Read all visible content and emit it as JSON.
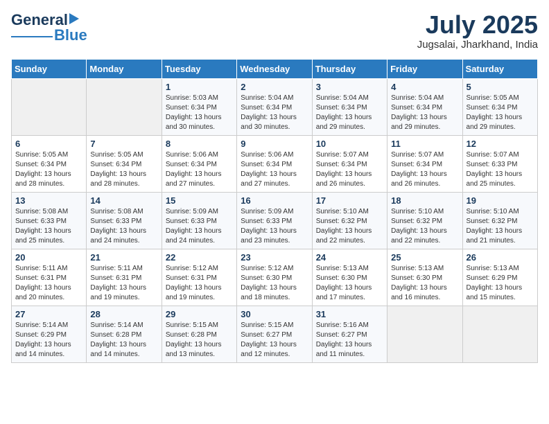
{
  "header": {
    "logo_general": "General",
    "logo_blue": "Blue",
    "month": "July 2025",
    "location": "Jugsalai, Jharkhand, India"
  },
  "days_of_week": [
    "Sunday",
    "Monday",
    "Tuesday",
    "Wednesday",
    "Thursday",
    "Friday",
    "Saturday"
  ],
  "weeks": [
    [
      {
        "day": "",
        "sunrise": "",
        "sunset": "",
        "daylight": ""
      },
      {
        "day": "",
        "sunrise": "",
        "sunset": "",
        "daylight": ""
      },
      {
        "day": "1",
        "sunrise": "Sunrise: 5:03 AM",
        "sunset": "Sunset: 6:34 PM",
        "daylight": "Daylight: 13 hours and 30 minutes."
      },
      {
        "day": "2",
        "sunrise": "Sunrise: 5:04 AM",
        "sunset": "Sunset: 6:34 PM",
        "daylight": "Daylight: 13 hours and 30 minutes."
      },
      {
        "day": "3",
        "sunrise": "Sunrise: 5:04 AM",
        "sunset": "Sunset: 6:34 PM",
        "daylight": "Daylight: 13 hours and 29 minutes."
      },
      {
        "day": "4",
        "sunrise": "Sunrise: 5:04 AM",
        "sunset": "Sunset: 6:34 PM",
        "daylight": "Daylight: 13 hours and 29 minutes."
      },
      {
        "day": "5",
        "sunrise": "Sunrise: 5:05 AM",
        "sunset": "Sunset: 6:34 PM",
        "daylight": "Daylight: 13 hours and 29 minutes."
      }
    ],
    [
      {
        "day": "6",
        "sunrise": "Sunrise: 5:05 AM",
        "sunset": "Sunset: 6:34 PM",
        "daylight": "Daylight: 13 hours and 28 minutes."
      },
      {
        "day": "7",
        "sunrise": "Sunrise: 5:05 AM",
        "sunset": "Sunset: 6:34 PM",
        "daylight": "Daylight: 13 hours and 28 minutes."
      },
      {
        "day": "8",
        "sunrise": "Sunrise: 5:06 AM",
        "sunset": "Sunset: 6:34 PM",
        "daylight": "Daylight: 13 hours and 27 minutes."
      },
      {
        "day": "9",
        "sunrise": "Sunrise: 5:06 AM",
        "sunset": "Sunset: 6:34 PM",
        "daylight": "Daylight: 13 hours and 27 minutes."
      },
      {
        "day": "10",
        "sunrise": "Sunrise: 5:07 AM",
        "sunset": "Sunset: 6:34 PM",
        "daylight": "Daylight: 13 hours and 26 minutes."
      },
      {
        "day": "11",
        "sunrise": "Sunrise: 5:07 AM",
        "sunset": "Sunset: 6:34 PM",
        "daylight": "Daylight: 13 hours and 26 minutes."
      },
      {
        "day": "12",
        "sunrise": "Sunrise: 5:07 AM",
        "sunset": "Sunset: 6:33 PM",
        "daylight": "Daylight: 13 hours and 25 minutes."
      }
    ],
    [
      {
        "day": "13",
        "sunrise": "Sunrise: 5:08 AM",
        "sunset": "Sunset: 6:33 PM",
        "daylight": "Daylight: 13 hours and 25 minutes."
      },
      {
        "day": "14",
        "sunrise": "Sunrise: 5:08 AM",
        "sunset": "Sunset: 6:33 PM",
        "daylight": "Daylight: 13 hours and 24 minutes."
      },
      {
        "day": "15",
        "sunrise": "Sunrise: 5:09 AM",
        "sunset": "Sunset: 6:33 PM",
        "daylight": "Daylight: 13 hours and 24 minutes."
      },
      {
        "day": "16",
        "sunrise": "Sunrise: 5:09 AM",
        "sunset": "Sunset: 6:33 PM",
        "daylight": "Daylight: 13 hours and 23 minutes."
      },
      {
        "day": "17",
        "sunrise": "Sunrise: 5:10 AM",
        "sunset": "Sunset: 6:32 PM",
        "daylight": "Daylight: 13 hours and 22 minutes."
      },
      {
        "day": "18",
        "sunrise": "Sunrise: 5:10 AM",
        "sunset": "Sunset: 6:32 PM",
        "daylight": "Daylight: 13 hours and 22 minutes."
      },
      {
        "day": "19",
        "sunrise": "Sunrise: 5:10 AM",
        "sunset": "Sunset: 6:32 PM",
        "daylight": "Daylight: 13 hours and 21 minutes."
      }
    ],
    [
      {
        "day": "20",
        "sunrise": "Sunrise: 5:11 AM",
        "sunset": "Sunset: 6:31 PM",
        "daylight": "Daylight: 13 hours and 20 minutes."
      },
      {
        "day": "21",
        "sunrise": "Sunrise: 5:11 AM",
        "sunset": "Sunset: 6:31 PM",
        "daylight": "Daylight: 13 hours and 19 minutes."
      },
      {
        "day": "22",
        "sunrise": "Sunrise: 5:12 AM",
        "sunset": "Sunset: 6:31 PM",
        "daylight": "Daylight: 13 hours and 19 minutes."
      },
      {
        "day": "23",
        "sunrise": "Sunrise: 5:12 AM",
        "sunset": "Sunset: 6:30 PM",
        "daylight": "Daylight: 13 hours and 18 minutes."
      },
      {
        "day": "24",
        "sunrise": "Sunrise: 5:13 AM",
        "sunset": "Sunset: 6:30 PM",
        "daylight": "Daylight: 13 hours and 17 minutes."
      },
      {
        "day": "25",
        "sunrise": "Sunrise: 5:13 AM",
        "sunset": "Sunset: 6:30 PM",
        "daylight": "Daylight: 13 hours and 16 minutes."
      },
      {
        "day": "26",
        "sunrise": "Sunrise: 5:13 AM",
        "sunset": "Sunset: 6:29 PM",
        "daylight": "Daylight: 13 hours and 15 minutes."
      }
    ],
    [
      {
        "day": "27",
        "sunrise": "Sunrise: 5:14 AM",
        "sunset": "Sunset: 6:29 PM",
        "daylight": "Daylight: 13 hours and 14 minutes."
      },
      {
        "day": "28",
        "sunrise": "Sunrise: 5:14 AM",
        "sunset": "Sunset: 6:28 PM",
        "daylight": "Daylight: 13 hours and 14 minutes."
      },
      {
        "day": "29",
        "sunrise": "Sunrise: 5:15 AM",
        "sunset": "Sunset: 6:28 PM",
        "daylight": "Daylight: 13 hours and 13 minutes."
      },
      {
        "day": "30",
        "sunrise": "Sunrise: 5:15 AM",
        "sunset": "Sunset: 6:27 PM",
        "daylight": "Daylight: 13 hours and 12 minutes."
      },
      {
        "day": "31",
        "sunrise": "Sunrise: 5:16 AM",
        "sunset": "Sunset: 6:27 PM",
        "daylight": "Daylight: 13 hours and 11 minutes."
      },
      {
        "day": "",
        "sunrise": "",
        "sunset": "",
        "daylight": ""
      },
      {
        "day": "",
        "sunrise": "",
        "sunset": "",
        "daylight": ""
      }
    ]
  ]
}
